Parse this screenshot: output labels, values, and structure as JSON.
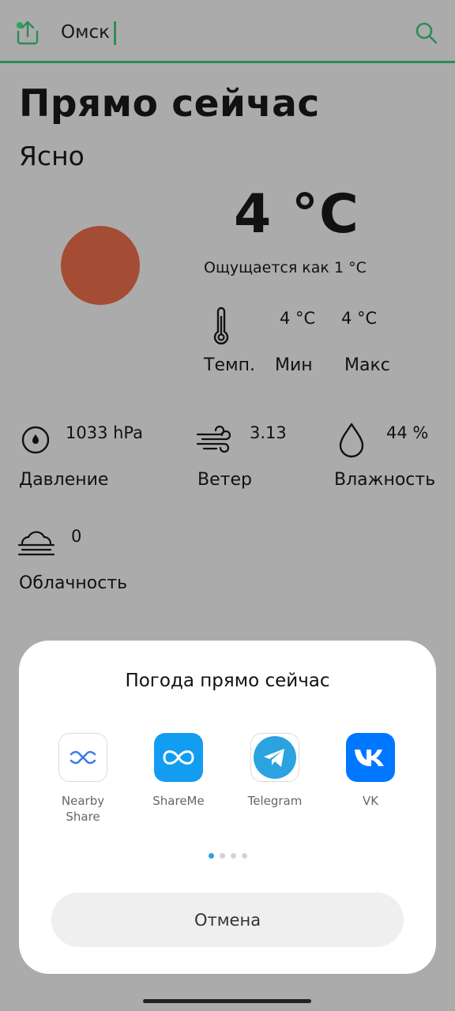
{
  "header": {
    "city": "Омск"
  },
  "main": {
    "heading": "Прямо сейчас",
    "condition": "Ясно",
    "temperature": "4 °C",
    "feels_like": "Ощущается как 1 °C",
    "temp_min": "4 °C",
    "temp_max": "4 °C",
    "labels": {
      "temp": "Темп.",
      "min": "Мин",
      "max": "Макс"
    },
    "pressure": {
      "value": "1033 hPa",
      "label": "Давление"
    },
    "wind": {
      "value": "3.13",
      "label": "Ветер"
    },
    "humidity": {
      "value": "44 %",
      "label": "Влажность"
    },
    "clouds": {
      "value": "0",
      "label": "Облачность"
    }
  },
  "share_sheet": {
    "title": "Погода прямо сейчас",
    "apps": [
      {
        "label": "Nearby Share",
        "icon": "nearby-share-icon"
      },
      {
        "label": "ShareMe",
        "icon": "shareme-icon"
      },
      {
        "label": "Telegram",
        "icon": "telegram-icon"
      },
      {
        "label": "VK",
        "icon": "vk-icon"
      }
    ],
    "page_count": 4,
    "active_page": 1,
    "cancel_label": "Отмена"
  },
  "colors": {
    "accent": "#2e8b57",
    "sun": "#a44c34",
    "shareme": "#139df0",
    "telegram": "#2aa3e0",
    "vk": "#0077ff",
    "active_dot": "#2aa0e6"
  }
}
